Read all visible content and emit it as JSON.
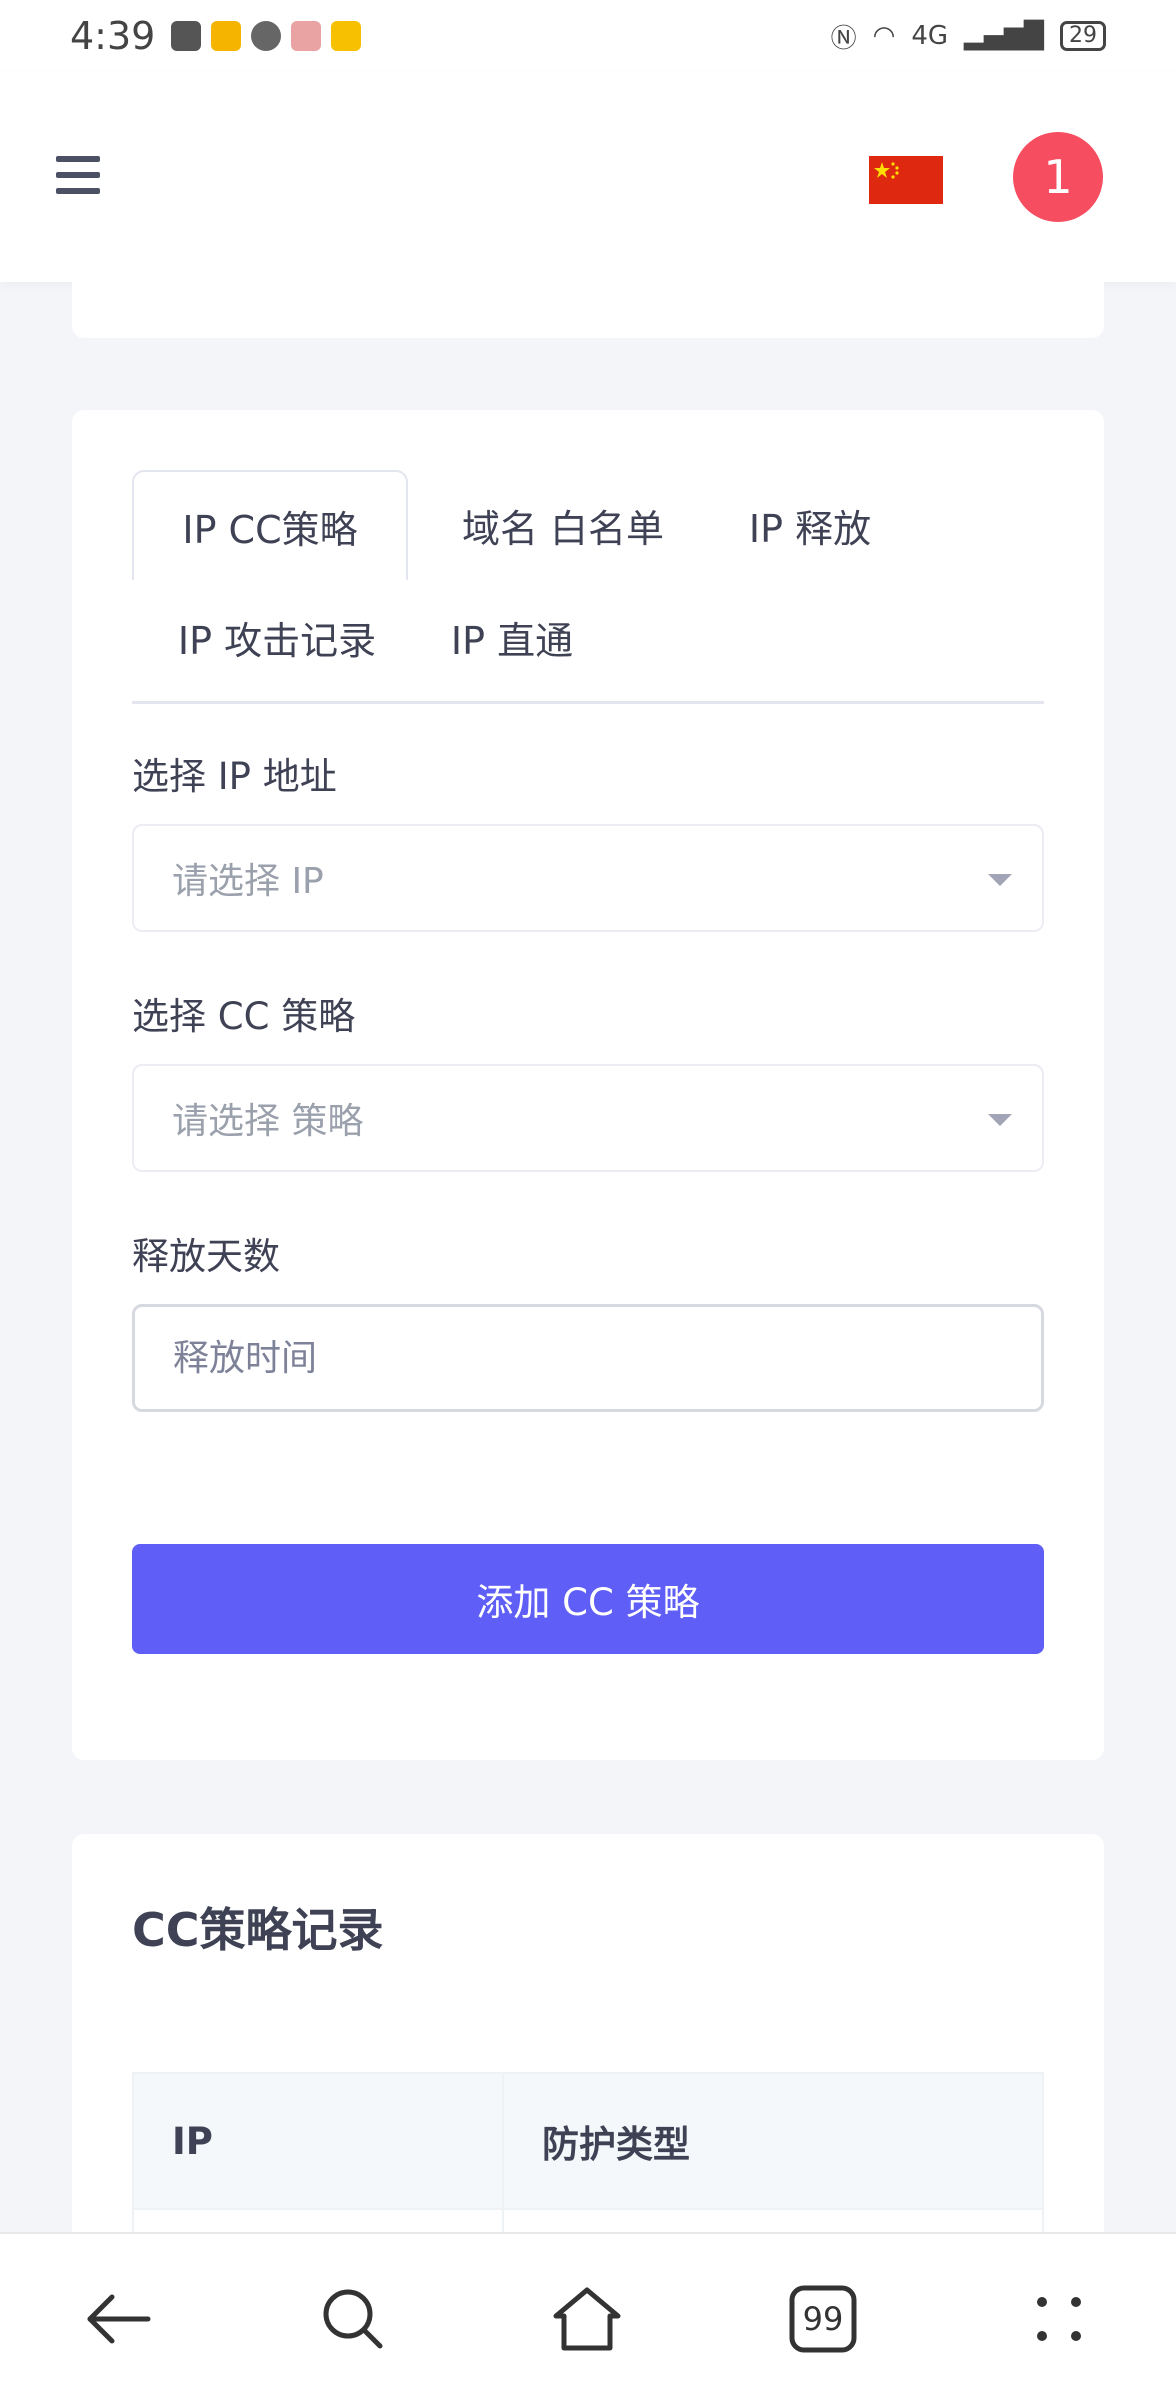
{
  "status_bar": {
    "time": "4:39",
    "network": "4G",
    "battery": "29"
  },
  "header": {
    "notification_count": "1"
  },
  "tabs": [
    {
      "label": "IP CC策略"
    },
    {
      "label": "域名 白名单"
    },
    {
      "label": "IP 释放"
    },
    {
      "label": "IP 攻击记录"
    },
    {
      "label": "IP 直通"
    }
  ],
  "form": {
    "ip_label": "选择 IP 地址",
    "ip_placeholder": "请选择 IP",
    "policy_label": "选择 CC 策略",
    "policy_placeholder": "请选择 策略",
    "days_label": "释放天数",
    "days_placeholder": "释放时间",
    "submit_label": "添加 CC 策略"
  },
  "records": {
    "title": "CC策略记录",
    "columns": [
      "IP",
      "防护类型"
    ]
  },
  "bottom_nav": {
    "tab_count": "99"
  },
  "colors": {
    "primary": "#5f5ff7",
    "badge": "#f64e60",
    "flag_red": "#de2910",
    "flag_yellow": "#ffde00"
  }
}
